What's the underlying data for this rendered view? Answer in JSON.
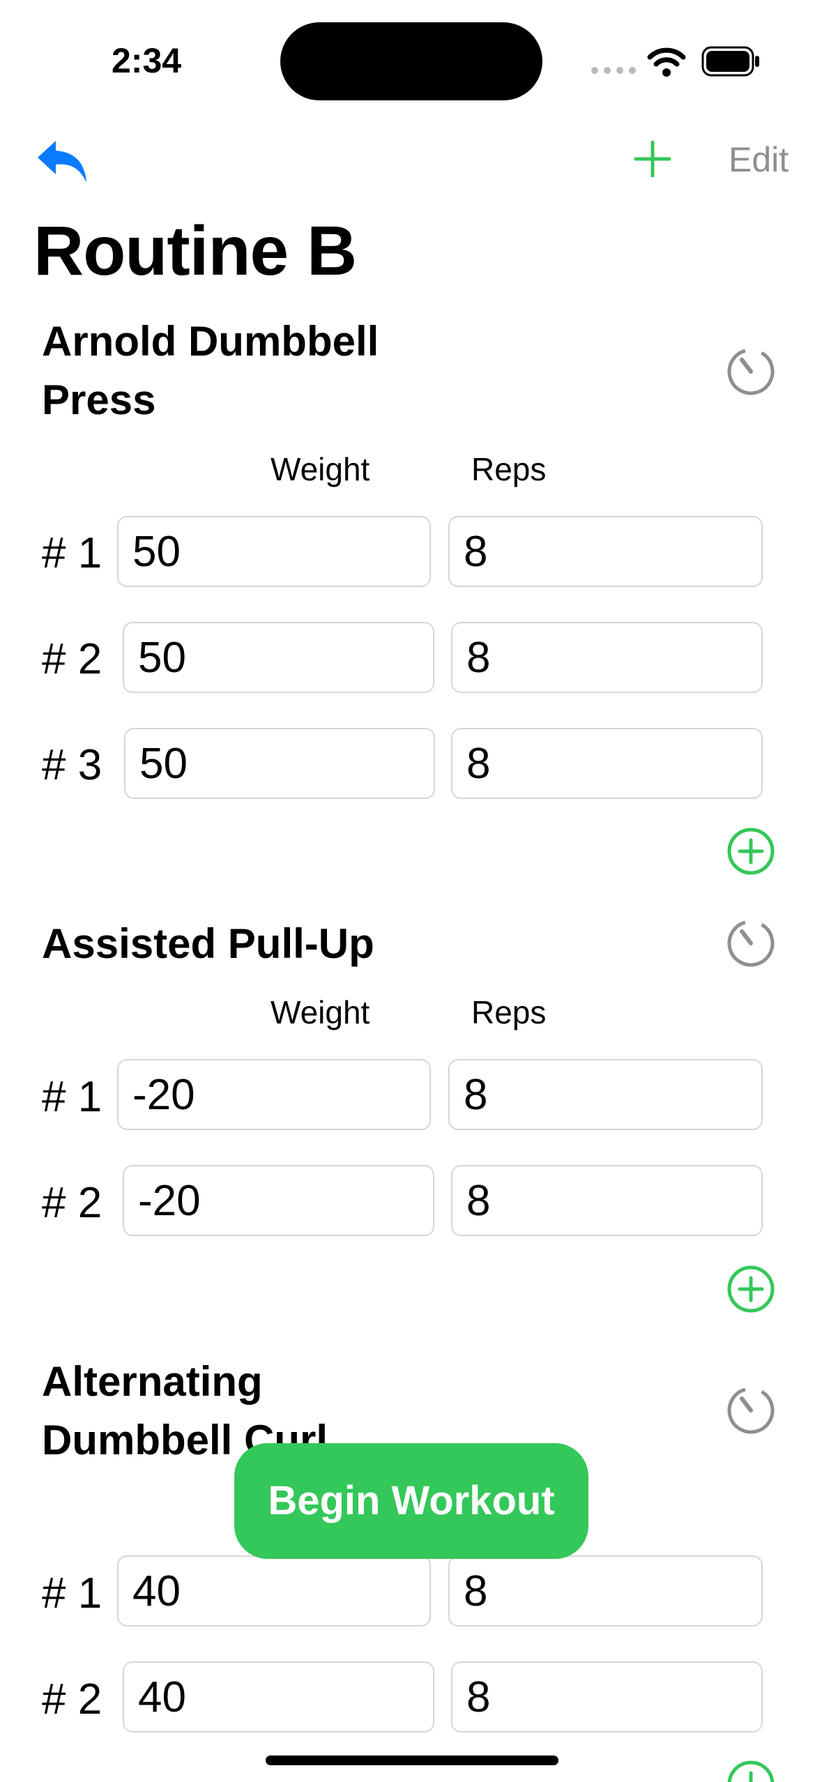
{
  "status_bar": {
    "time": "2:34"
  },
  "nav": {
    "edit_label": "Edit"
  },
  "routine": {
    "title": "Routine B",
    "weight_header": "Weight",
    "reps_header": "Reps",
    "exercises": [
      {
        "name": "Arnold Dumbbell Press",
        "sets": [
          {
            "label": "# 1",
            "weight": "50",
            "reps": "8"
          },
          {
            "label": "# 2",
            "weight": "50",
            "reps": "8"
          },
          {
            "label": "# 3",
            "weight": "50",
            "reps": "8"
          }
        ]
      },
      {
        "name": "Assisted Pull-Up",
        "sets": [
          {
            "label": "# 1",
            "weight": "-20",
            "reps": "8"
          },
          {
            "label": "# 2",
            "weight": "-20",
            "reps": "8"
          }
        ]
      },
      {
        "name": "Alternating Dumbbell Curl",
        "sets": [
          {
            "label": "# 1",
            "weight": "40",
            "reps": "8"
          },
          {
            "label": "# 2",
            "weight": "40",
            "reps": "8"
          }
        ]
      }
    ]
  },
  "begin_button": {
    "label": "Begin Workout"
  },
  "colors": {
    "accent_green": "#34c759",
    "back_blue": "#0a7aff",
    "gray": "#8e8e93"
  },
  "icons": [
    "back-arrow-icon",
    "plus-icon",
    "timer-icon",
    "add-circle-icon",
    "wifi-icon",
    "battery-icon"
  ]
}
